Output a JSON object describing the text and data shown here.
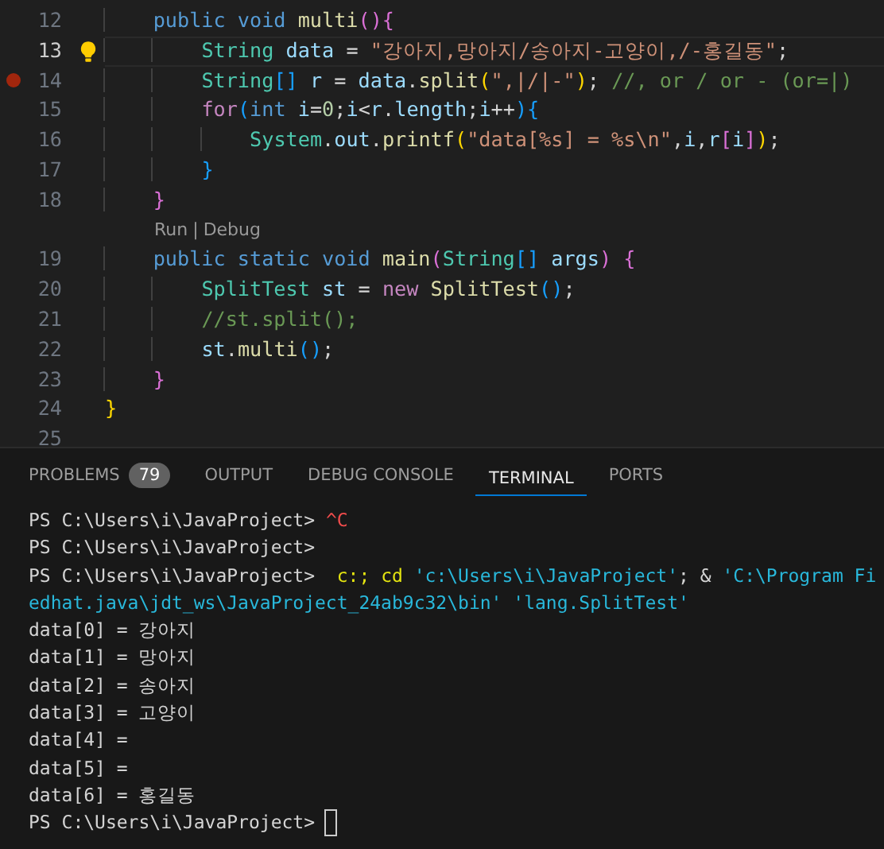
{
  "editor": {
    "lines": [
      {
        "kind": "code",
        "number": "12",
        "current": false,
        "breakpoint": false,
        "lightbulb": false,
        "tokens": [
          {
            "text": "    public",
            "kind": "kw"
          },
          {
            "text": " void",
            "kind": "kw"
          },
          {
            "text": " multi",
            "kind": "fn"
          },
          {
            "text": "(){",
            "kind": "br2"
          }
        ]
      },
      {
        "kind": "code",
        "number": "13",
        "current": true,
        "breakpoint": false,
        "lightbulb": true,
        "tokens": [
          {
            "text": "        String",
            "kind": "type"
          },
          {
            "text": " data",
            "kind": "var"
          },
          {
            "text": " = ",
            "kind": "plain"
          },
          {
            "text": "\"강아지,망아지/송아지-고양이,/-홍길동\"",
            "kind": "str"
          },
          {
            "text": ";",
            "kind": "plain"
          }
        ]
      },
      {
        "kind": "code",
        "number": "14",
        "current": false,
        "breakpoint": true,
        "lightbulb": false,
        "tokens": [
          {
            "text": "        String",
            "kind": "type"
          },
          {
            "text": "[]",
            "kind": "br3"
          },
          {
            "text": " r",
            "kind": "var"
          },
          {
            "text": " = ",
            "kind": "plain"
          },
          {
            "text": "data",
            "kind": "var"
          },
          {
            "text": ".",
            "kind": "plain"
          },
          {
            "text": "split",
            "kind": "fn"
          },
          {
            "text": "(",
            "kind": "br1"
          },
          {
            "text": "\",|/|-\"",
            "kind": "str"
          },
          {
            "text": ")",
            "kind": "br1"
          },
          {
            "text": "; ",
            "kind": "plain"
          },
          {
            "text": "//, or / or - (or=|)",
            "kind": "comment"
          }
        ]
      },
      {
        "kind": "code",
        "number": "15",
        "current": false,
        "breakpoint": false,
        "lightbulb": false,
        "tokens": [
          {
            "text": "        for",
            "kind": "ctrl"
          },
          {
            "text": "(",
            "kind": "br3"
          },
          {
            "text": "int",
            "kind": "kw"
          },
          {
            "text": " i",
            "kind": "var"
          },
          {
            "text": "=",
            "kind": "plain"
          },
          {
            "text": "0",
            "kind": "num"
          },
          {
            "text": ";",
            "kind": "plain"
          },
          {
            "text": "i",
            "kind": "var"
          },
          {
            "text": "<",
            "kind": "plain"
          },
          {
            "text": "r",
            "kind": "var"
          },
          {
            "text": ".",
            "kind": "plain"
          },
          {
            "text": "length",
            "kind": "var"
          },
          {
            "text": ";",
            "kind": "plain"
          },
          {
            "text": "i",
            "kind": "var"
          },
          {
            "text": "++",
            "kind": "plain"
          },
          {
            "text": "){",
            "kind": "br3"
          }
        ]
      },
      {
        "kind": "code",
        "number": "16",
        "current": false,
        "breakpoint": false,
        "lightbulb": false,
        "tokens": [
          {
            "text": "            System",
            "kind": "type"
          },
          {
            "text": ".",
            "kind": "plain"
          },
          {
            "text": "out",
            "kind": "var"
          },
          {
            "text": ".",
            "kind": "plain"
          },
          {
            "text": "printf",
            "kind": "fn"
          },
          {
            "text": "(",
            "kind": "br1"
          },
          {
            "text": "\"data[%s] = %s\\n\"",
            "kind": "str"
          },
          {
            "text": ",",
            "kind": "plain"
          },
          {
            "text": "i",
            "kind": "var"
          },
          {
            "text": ",",
            "kind": "plain"
          },
          {
            "text": "r",
            "kind": "var"
          },
          {
            "text": "[",
            "kind": "br2"
          },
          {
            "text": "i",
            "kind": "var"
          },
          {
            "text": "]",
            "kind": "br2"
          },
          {
            "text": ")",
            "kind": "br1"
          },
          {
            "text": ";",
            "kind": "plain"
          }
        ]
      },
      {
        "kind": "code",
        "number": "17",
        "current": false,
        "breakpoint": false,
        "lightbulb": false,
        "tokens": [
          {
            "text": "        }",
            "kind": "br3"
          }
        ]
      },
      {
        "kind": "code",
        "number": "18",
        "current": false,
        "breakpoint": false,
        "lightbulb": false,
        "tokens": [
          {
            "text": "    }",
            "kind": "br2"
          }
        ]
      },
      {
        "kind": "codelens",
        "links": [
          {
            "label": "Run"
          },
          {
            "label": "Debug"
          }
        ],
        "separator": "|"
      },
      {
        "kind": "code",
        "number": "19",
        "current": false,
        "breakpoint": false,
        "lightbulb": false,
        "tokens": [
          {
            "text": "    public",
            "kind": "kw"
          },
          {
            "text": " static",
            "kind": "kw"
          },
          {
            "text": " void",
            "kind": "kw"
          },
          {
            "text": " main",
            "kind": "fn"
          },
          {
            "text": "(",
            "kind": "br2"
          },
          {
            "text": "String",
            "kind": "type"
          },
          {
            "text": "[]",
            "kind": "br3"
          },
          {
            "text": " args",
            "kind": "var"
          },
          {
            "text": ")",
            "kind": "br2"
          },
          {
            "text": " {",
            "kind": "br2"
          }
        ]
      },
      {
        "kind": "code",
        "number": "20",
        "current": false,
        "breakpoint": false,
        "lightbulb": false,
        "tokens": [
          {
            "text": "        SplitTest",
            "kind": "type"
          },
          {
            "text": " st",
            "kind": "var"
          },
          {
            "text": " = ",
            "kind": "plain"
          },
          {
            "text": "new",
            "kind": "ctrl"
          },
          {
            "text": " SplitTest",
            "kind": "fn"
          },
          {
            "text": "()",
            "kind": "br3"
          },
          {
            "text": ";",
            "kind": "plain"
          }
        ]
      },
      {
        "kind": "code",
        "number": "21",
        "current": false,
        "breakpoint": false,
        "lightbulb": false,
        "tokens": [
          {
            "text": "        //st.split();",
            "kind": "comment"
          }
        ]
      },
      {
        "kind": "code",
        "number": "22",
        "current": false,
        "breakpoint": false,
        "lightbulb": false,
        "tokens": [
          {
            "text": "        st",
            "kind": "var"
          },
          {
            "text": ".",
            "kind": "plain"
          },
          {
            "text": "multi",
            "kind": "fn"
          },
          {
            "text": "()",
            "kind": "br3"
          },
          {
            "text": ";",
            "kind": "plain"
          }
        ]
      },
      {
        "kind": "code",
        "number": "23",
        "current": false,
        "breakpoint": false,
        "lightbulb": false,
        "tokens": [
          {
            "text": "    }",
            "kind": "br2"
          }
        ]
      },
      {
        "kind": "code",
        "number": "24",
        "current": false,
        "breakpoint": false,
        "lightbulb": false,
        "tokens": [
          {
            "text": "}",
            "kind": "br1"
          }
        ]
      },
      {
        "kind": "code",
        "number": "25",
        "current": false,
        "breakpoint": false,
        "lightbulb": false
      }
    ]
  },
  "panel": {
    "tabs": [
      {
        "label": "PROBLEMS",
        "badge": "79",
        "selected": false
      },
      {
        "label": "OUTPUT",
        "selected": false
      },
      {
        "label": "DEBUG CONSOLE",
        "selected": false
      },
      {
        "label": "TERMINAL",
        "selected": true
      },
      {
        "label": "PORTS",
        "selected": false
      }
    ]
  },
  "terminal": {
    "cursor": true,
    "lines": [
      [
        {
          "text": "PS C:\\Users\\i\\JavaProject> ",
          "kind": "plain"
        },
        {
          "text": "^C",
          "kind": "error"
        }
      ],
      [
        {
          "text": "PS C:\\Users\\i\\JavaProject>",
          "kind": "plain"
        }
      ],
      [
        {
          "text": "PS C:\\Users\\i\\JavaProject>  ",
          "kind": "plain"
        },
        {
          "text": "c:; cd",
          "kind": "yellow"
        },
        {
          "text": " 'c:\\Users\\i\\JavaProject'",
          "kind": "cyan"
        },
        {
          "text": "; & ",
          "kind": "plain"
        },
        {
          "text": "'C:\\Program Fi",
          "kind": "cyan"
        }
      ],
      [
        {
          "text": "edhat.java\\jdt_ws\\JavaProject_24ab9c32\\bin'",
          "kind": "cyan"
        },
        {
          "text": " 'lang.SplitTest'",
          "kind": "cyan"
        }
      ],
      [
        {
          "text": "data[0] = 강아지",
          "kind": "plain"
        }
      ],
      [
        {
          "text": "data[1] = 망아지",
          "kind": "plain"
        }
      ],
      [
        {
          "text": "data[2] = 송아지",
          "kind": "plain"
        }
      ],
      [
        {
          "text": "data[3] = 고양이",
          "kind": "plain"
        }
      ],
      [
        {
          "text": "data[4] =",
          "kind": "plain"
        }
      ],
      [
        {
          "text": "data[5] =",
          "kind": "plain"
        }
      ],
      [
        {
          "text": "data[6] = 홍길동",
          "kind": "plain"
        }
      ],
      [
        {
          "text": "PS C:\\Users\\i\\JavaProject>",
          "kind": "plain"
        }
      ]
    ]
  }
}
